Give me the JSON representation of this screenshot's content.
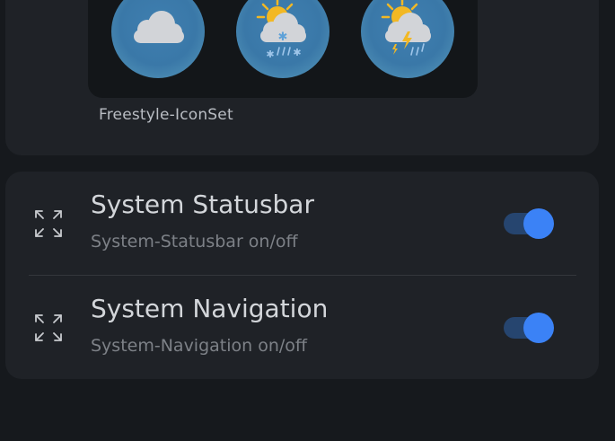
{
  "iconset": {
    "label": "Freestyle-IconSet",
    "icons": [
      "cloudy-weather-icon",
      "snow-sleet-weather-icon",
      "thunderstorm-weather-icon"
    ]
  },
  "settings": [
    {
      "title": "System Statusbar",
      "subtitle": "System-Statusbar on/off",
      "icon": "expand-arrows-icon",
      "enabled": true
    },
    {
      "title": "System Navigation",
      "subtitle": "System-Navigation on/off",
      "icon": "expand-arrows-icon",
      "enabled": true
    }
  ],
  "colors": {
    "background": "#16191d",
    "card": "#1f2227",
    "accent": "#3b82f6",
    "track": "#26456f"
  }
}
